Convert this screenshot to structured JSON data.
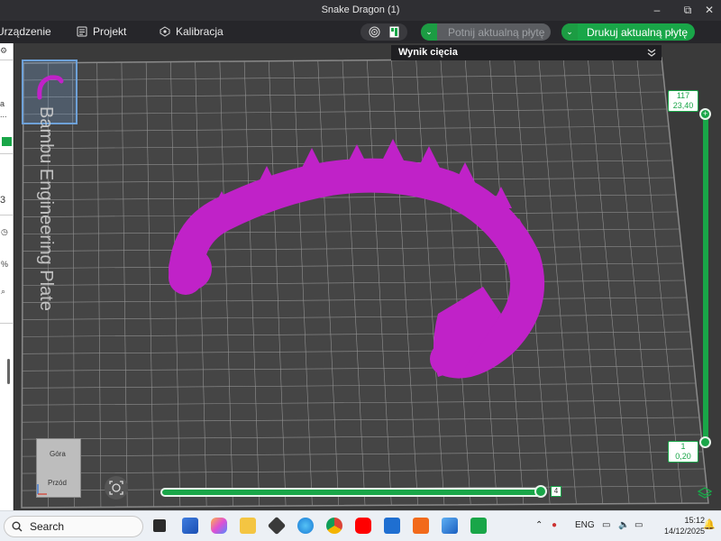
{
  "window": {
    "title": "Snake Dragon (1)",
    "controls": {
      "minimize": "–",
      "restore": "⧉",
      "close": "✕"
    }
  },
  "menubar": {
    "items": [
      {
        "label": "Urządzenie",
        "icon": "device-icon"
      },
      {
        "label": "Projekt",
        "icon": "project-icon"
      },
      {
        "label": "Kalibracja",
        "icon": "calibration-icon"
      }
    ],
    "slice_button": "Potnij aktualną płytę",
    "print_button": "Drukuj aktualną płytę"
  },
  "left_panel": {
    "fragments": [
      "a",
      "...",
      "3"
    ]
  },
  "viewport": {
    "slice_panel_title": "Wynik cięcia",
    "plate_label": "Bambu Engineering Plate",
    "layer_top": {
      "layer": "117",
      "height": "23,40"
    },
    "layer_bottom": {
      "layer": "1",
      "height": "0,20"
    },
    "view_cube": {
      "top": "Góra",
      "front": "Przód"
    },
    "horizontal_slider_value": "4",
    "model_color": "#c022c8",
    "accent_color": "#19a648"
  },
  "taskbar": {
    "search_placeholder": "Search",
    "language": "ENG",
    "time": "15:12",
    "date": "14/12/2025"
  }
}
